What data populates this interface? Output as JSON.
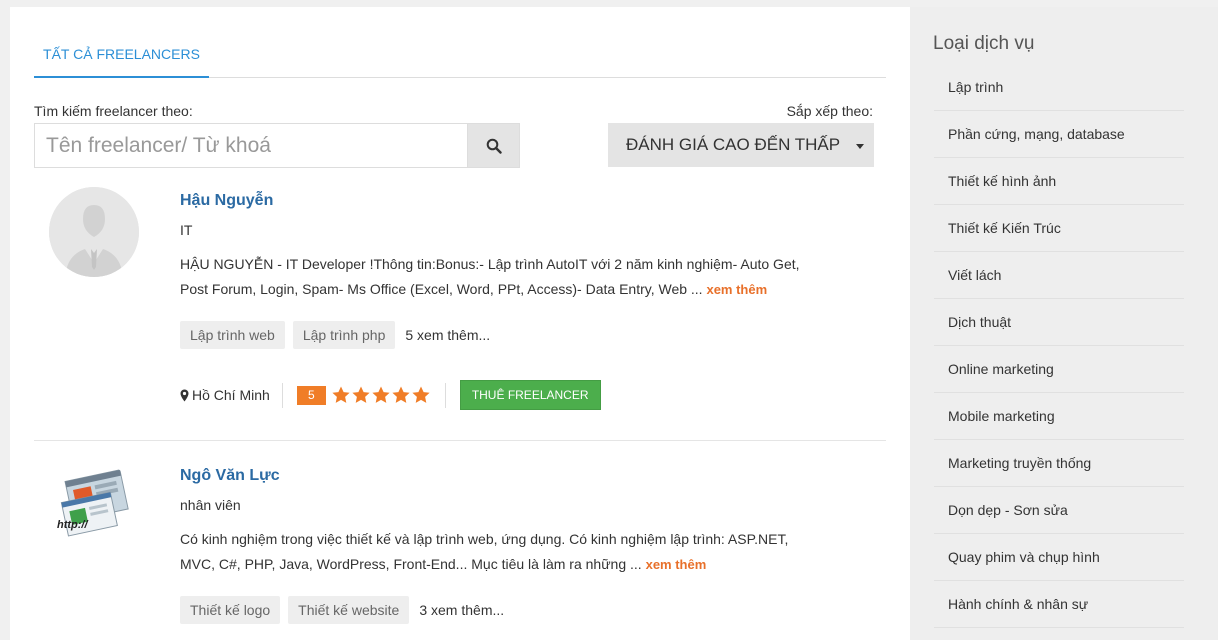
{
  "tabs": {
    "all_freelancers": "TẤT CẢ FREELANCERS"
  },
  "search": {
    "label": "Tìm kiếm freelancer theo:",
    "placeholder": "Tên freelancer/ Từ khoá",
    "button_icon": "search-icon"
  },
  "sort": {
    "label": "Sắp xếp theo:",
    "selected": "ĐÁNH GIÁ CAO ĐẾN THẤP"
  },
  "freelancers": [
    {
      "name": "Hậu Nguyễn",
      "title": "IT",
      "description": "HẬU NGUYỄN - IT Developer !Thông tin:Bonus:- Lập trình AutoIT với 2 năm kinh nghiệm- Auto Get, Post Forum, Login, Spam- Ms Office (Excel, Word, PPt, Access)- Data Entry, Web ...",
      "more_link": "xem thêm",
      "skills": [
        "Lập trình web",
        "Lập trình php"
      ],
      "skills_more": "5 xem thêm...",
      "location": "Hồ Chí Minh",
      "rating": "5",
      "stars": 5,
      "hire_label": "THUÊ FREELANCER"
    },
    {
      "name": "Ngô Văn Lực",
      "title": "nhân viên",
      "description": "Có kinh nghiệm trong việc thiết kế và lập trình web, ứng dụng. Có kinh nghiệm lập trình: ASP.NET, MVC, C#, PHP, Java, WordPress, Front-End... Mục tiêu là làm ra những ...",
      "more_link": "xem thêm",
      "skills": [
        "Thiết kế logo",
        "Thiết kế website"
      ],
      "skills_more": "3 xem thêm...",
      "avatar_text": "http://"
    }
  ],
  "sidebar": {
    "title": "Loại dịch vụ",
    "items": [
      "Lập trình",
      "Phần cứng, mạng, database",
      "Thiết kế hình ảnh",
      "Thiết kế Kiến Trúc",
      "Viết lách",
      "Dịch thuật",
      "Online marketing",
      "Mobile marketing",
      "Marketing truyền thống",
      "Dọn dẹp - Sơn sửa",
      "Quay phim và chụp hình",
      "Hành chính & nhân sự"
    ]
  },
  "colors": {
    "accent": "#2c8fd6",
    "name_link": "#2b6aa3",
    "more_link": "#e8702a",
    "rating": "#f07d27",
    "hire": "#4cae4c"
  }
}
